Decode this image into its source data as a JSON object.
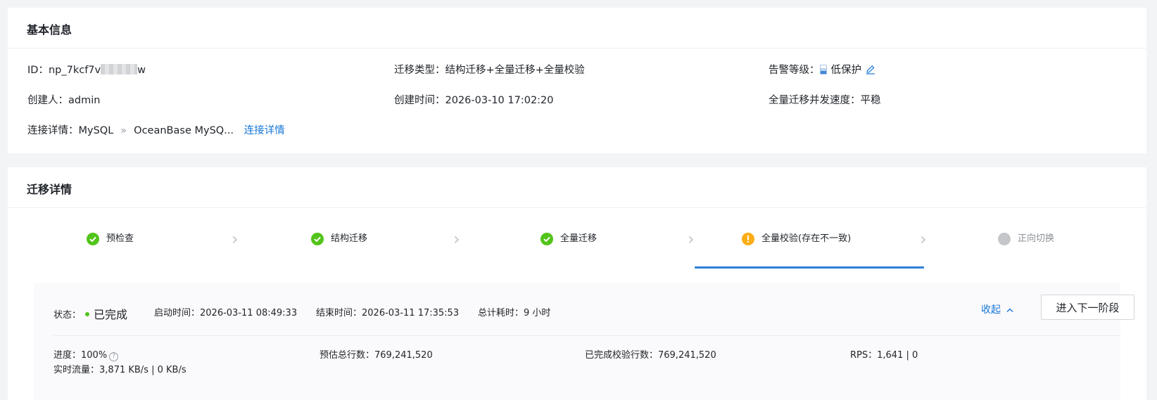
{
  "basic_info": {
    "title": "基本信息",
    "id_label": "ID：",
    "id_value": "np_7kcf7v",
    "id_suffix": "w",
    "migration_type_label": "迁移类型：",
    "migration_type_value": "结构迁移+全量迁移+全量校验",
    "alarm_label": "告警等级：",
    "alarm_value": "低保护",
    "creator_label": "创建人：",
    "creator_value": "admin",
    "create_time_label": "创建时间：",
    "create_time_value": "2026-03-10 17:02:20",
    "speed_label": "全量迁移并发速度：",
    "speed_value": "平稳",
    "connection_label": "连接详情：",
    "source": "MySQL",
    "separator": "»",
    "target": "OceanBase MySQ...",
    "connection_link": "连接详情"
  },
  "migration": {
    "title": "迁移详情",
    "steps": [
      {
        "label": "预检查",
        "status": "done"
      },
      {
        "label": "结构迁移",
        "status": "done"
      },
      {
        "label": "全量迁移",
        "status": "done"
      },
      {
        "label": "全量校验(存在不一致)",
        "status": "warning"
      },
      {
        "label": "正向切换",
        "status": "pending"
      }
    ],
    "chevron": "›",
    "detail": {
      "status_label": "状态：",
      "status_value": "已完成",
      "start_label": "启动时间：",
      "start_value": "2026-03-11 08:49:33",
      "end_label": "结束时间：",
      "end_value": "2026-03-11 17:35:53",
      "duration_label": "总计耗时：",
      "duration_value": "9 小时",
      "collapse_label": "收起",
      "collapse_arrow": "^",
      "next_button": "进入下一阶段",
      "progress_label": "进度：",
      "progress_value": "100%",
      "help_glyph": "?",
      "traffic_label": "实时流量：",
      "traffic_value": "3,871 KB/s | 0 KB/s",
      "estimated_label": "预估总行数：",
      "estimated_value": "769,241,520",
      "completed_label": "已完成校验行数：",
      "completed_value": "769,241,520",
      "rps_label": "RPS：",
      "rps_value": "1,641 | 0"
    }
  },
  "colors": {
    "success": "#52c41a",
    "warning": "#faad14",
    "pending": "#c4c6ca",
    "link": "#1677d8",
    "active_tab": "#2f7fd6"
  }
}
